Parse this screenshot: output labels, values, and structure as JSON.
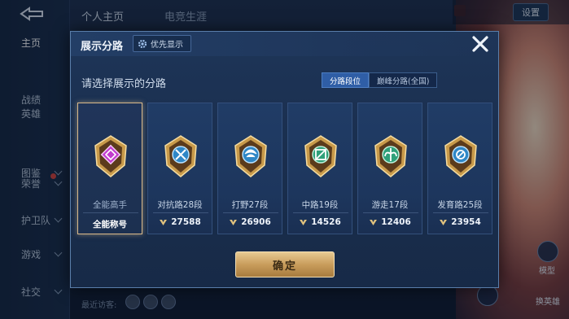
{
  "background": {
    "nav": [
      {
        "label": "主页",
        "active": true,
        "chevron": false,
        "dot": false
      },
      {
        "label": "战绩",
        "active": false,
        "chevron": false,
        "dot": false
      },
      {
        "label": "英雄",
        "active": false,
        "chevron": false,
        "dot": false
      },
      {
        "label": "图鉴",
        "active": false,
        "chevron": true,
        "dot": false
      },
      {
        "label": "荣誉",
        "active": false,
        "chevron": true,
        "dot": true
      },
      {
        "label": "护卫队",
        "active": false,
        "chevron": true,
        "dot": false
      },
      {
        "label": "游戏",
        "active": false,
        "chevron": true,
        "dot": false
      },
      {
        "label": "社交",
        "active": false,
        "chevron": true,
        "dot": false
      }
    ],
    "tabs": {
      "primary": "个人主页",
      "secondary": "电竞生涯"
    },
    "settings_label": "设置",
    "recent_visitors_label": "最近访客:",
    "right_labels": {
      "model": "模型",
      "hero": "换英雄"
    }
  },
  "modal": {
    "title": "展示分路",
    "priority_label": "优先显示",
    "subtitle": "请选择展示的分路",
    "segments": [
      {
        "label": "分路段位",
        "active": true
      },
      {
        "label": "巅峰分路(全国)",
        "active": false
      }
    ],
    "cards": [
      {
        "name": "全能高手",
        "stat": "全能称号",
        "type": "title",
        "selected": true,
        "emblem": "all-round-emblem"
      },
      {
        "name": "对抗路28段",
        "stat": "27588",
        "type": "score",
        "selected": false,
        "emblem": "clash-lane-emblem"
      },
      {
        "name": "打野27段",
        "stat": "26906",
        "type": "score",
        "selected": false,
        "emblem": "jungle-emblem"
      },
      {
        "name": "中路19段",
        "stat": "14526",
        "type": "score",
        "selected": false,
        "emblem": "mid-lane-emblem"
      },
      {
        "name": "游走17段",
        "stat": "12406",
        "type": "score",
        "selected": false,
        "emblem": "roam-emblem"
      },
      {
        "name": "发育路25段",
        "stat": "23954",
        "type": "score",
        "selected": false,
        "emblem": "farm-lane-emblem"
      }
    ],
    "confirm_label": "确定"
  },
  "colors": {
    "accent_gold": "#d9b98a",
    "segment_active": "#2f5ea6",
    "card_bg": "#203c66"
  }
}
